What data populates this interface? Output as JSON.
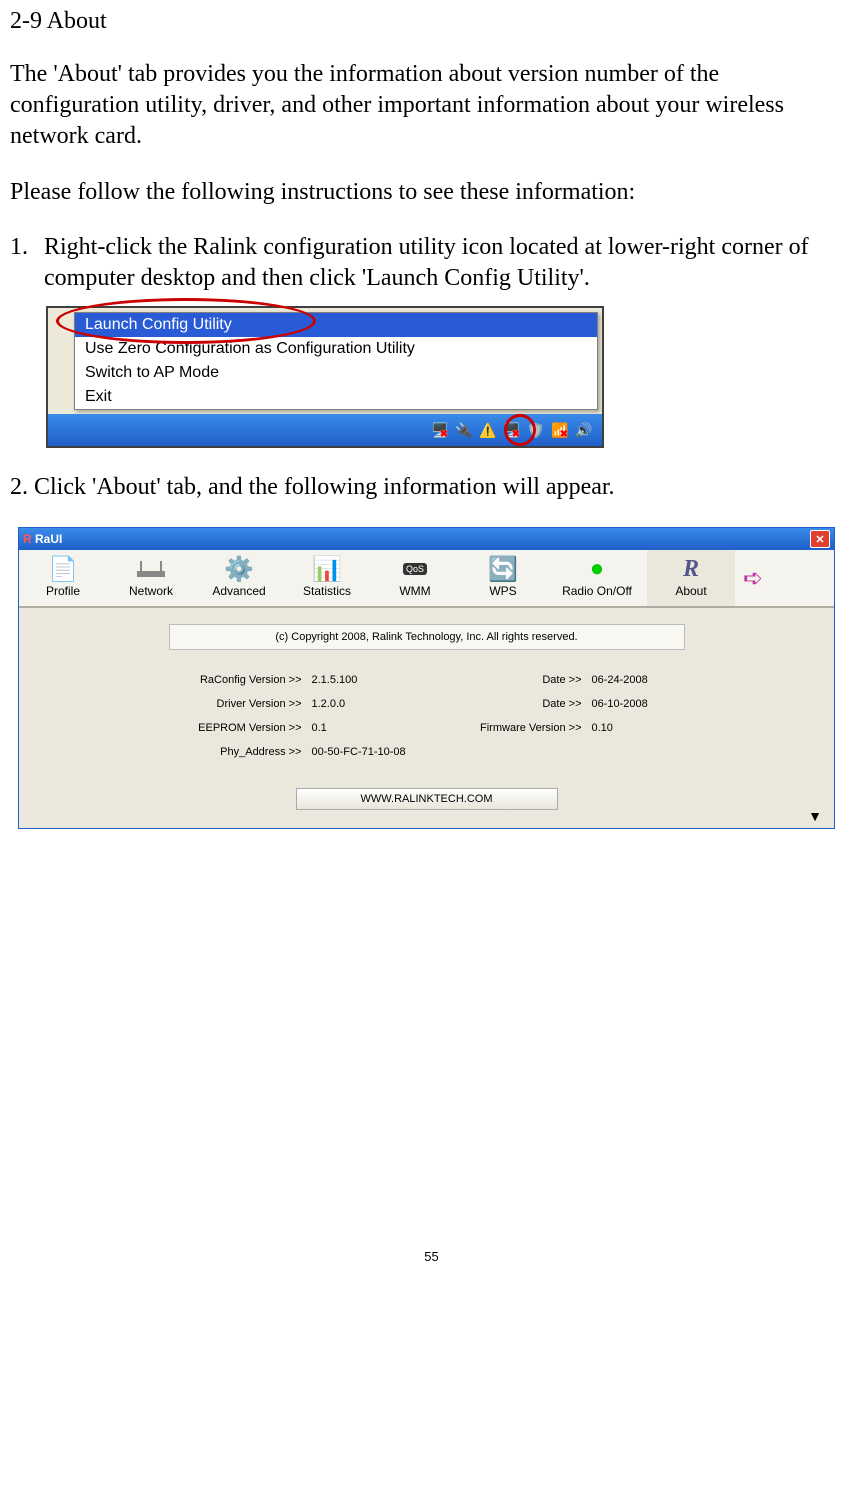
{
  "doc": {
    "heading": "2-9 About",
    "para1": "The 'About' tab provides you the information about version number of the configuration utility, driver, and other important information about your wireless network card.",
    "para2": "Please follow the following instructions to see these information:",
    "step1_num": "1.",
    "step1": "Right-click the Ralink configuration utility icon located at lower-right corner of computer desktop and then click 'Launch Config Utility'.",
    "step2": "2. Click 'About' tab, and the following information will appear.",
    "page_number": "55"
  },
  "context_menu": {
    "items": [
      "Launch Config Utility",
      "Use Zero Configuration as Configuration Utility",
      "Switch to AP Mode",
      "Exit"
    ]
  },
  "raui": {
    "title": "RaUI",
    "tabs": [
      "Profile",
      "Network",
      "Advanced",
      "Statistics",
      "WMM",
      "WPS",
      "Radio On/Off",
      "About"
    ],
    "copyright": "(c) Copyright 2008, Ralink Technology, Inc. All rights reserved.",
    "info": {
      "raconfig_label": "RaConfig Version >>",
      "raconfig_value": "2.1.5.100",
      "raconfig_date_label": "Date >>",
      "raconfig_date": "06-24-2008",
      "driver_label": "Driver Version >>",
      "driver_value": "1.2.0.0",
      "driver_date_label": "Date >>",
      "driver_date": "06-10-2008",
      "eeprom_label": "EEPROM Version >>",
      "eeprom_value": "0.1",
      "firmware_label": "Firmware Version >>",
      "firmware_value": "0.10",
      "phy_label": "Phy_Address >>",
      "phy_value": "00-50-FC-71-10-08"
    },
    "link": "WWW.RALINKTECH.COM"
  }
}
